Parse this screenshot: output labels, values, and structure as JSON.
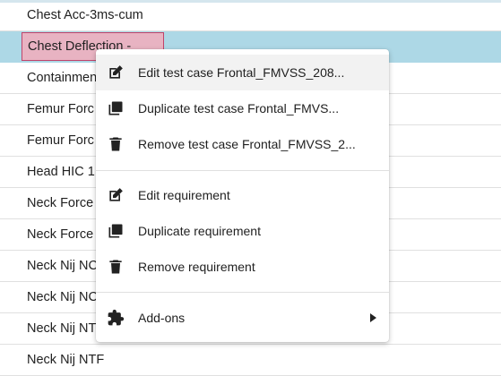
{
  "table": {
    "rows": [
      "Chest Acc-3ms-cum",
      "Chest Deflection -",
      "Containmen",
      "Femur Forc",
      "Femur Forc",
      "Head HIC 1",
      "Neck Force",
      "Neck Force",
      "Neck Nij NC",
      "Neck Nij NC",
      "Neck Nij NT",
      "Neck Nij NTF"
    ],
    "selected_index": 1
  },
  "context_menu": {
    "edit_test_case": "Edit test case Frontal_FMVSS_208...",
    "duplicate_test_case": "Duplicate test case Frontal_FMVS...",
    "remove_test_case": "Remove test case Frontal_FMVSS_2...",
    "edit_requirement": "Edit requirement",
    "duplicate_requirement": "Duplicate requirement",
    "remove_requirement": "Remove requirement",
    "addons": "Add-ons"
  },
  "icons": {
    "edit": "pencil-icon",
    "duplicate": "duplicate-icon",
    "remove": "trash-icon",
    "addons": "puzzle-icon",
    "submenu": "arrow-right-icon"
  },
  "colors": {
    "selected_row": "#add8e6",
    "selected_cell": "#e8b3c2",
    "selected_cell_border": "#c0446a"
  }
}
